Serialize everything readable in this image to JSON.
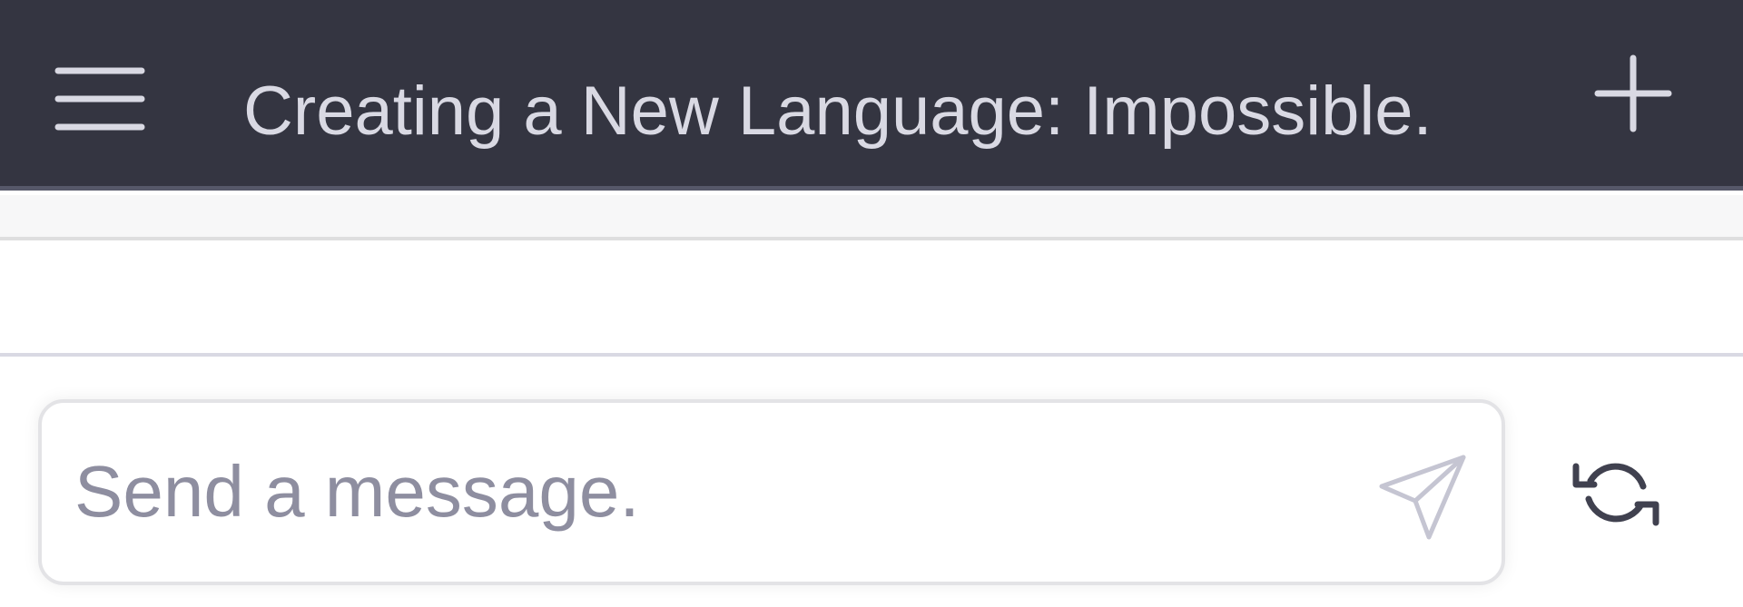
{
  "header": {
    "title": "Creating a New Language: Impossible.",
    "menu_icon": "hamburger-menu-icon",
    "new_chat_icon": "plus-icon"
  },
  "composer": {
    "placeholder": "Send a message.",
    "value": "",
    "send_icon": "paper-plane-send-icon",
    "regenerate_icon": "refresh-icon"
  },
  "colors": {
    "header_bg": "#343541",
    "header_text": "#d9d9e3",
    "placeholder_text": "#8e8ea0",
    "send_icon": "#c5c5d2",
    "regenerate_icon": "#40414f"
  }
}
